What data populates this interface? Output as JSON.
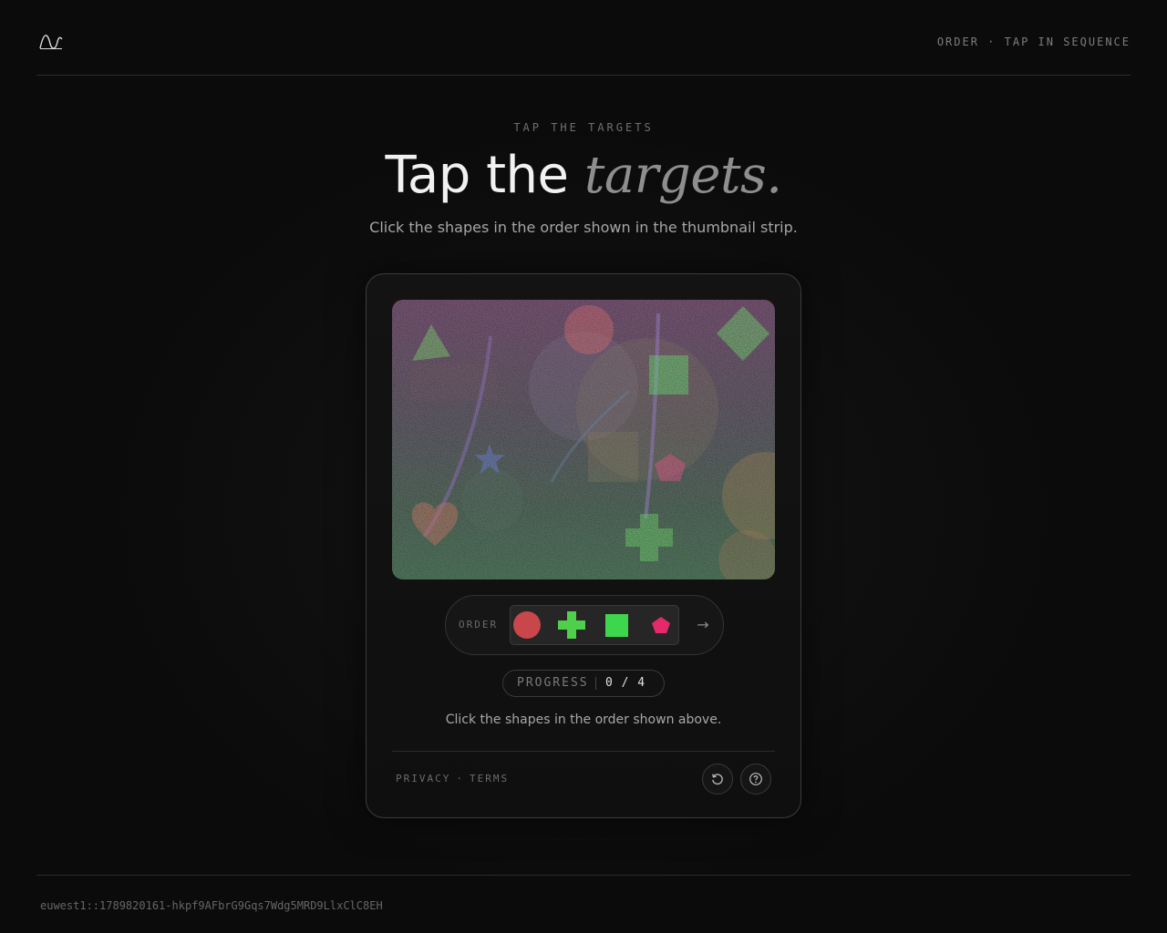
{
  "header": {
    "logo_icon": "wave-logo-icon",
    "mode_label": "ORDER · TAP IN SEQUENCE"
  },
  "hero": {
    "eyebrow": "TAP THE TARGETS",
    "title_plain": "Tap the",
    "title_emphasis": "targets.",
    "subtitle": "Click the shapes in the order shown in the thumbnail strip."
  },
  "challenge": {
    "canvas_shapes": [
      "green-triangle",
      "red-circle",
      "green-diamond",
      "green-square",
      "blue-star",
      "pink-pentagon",
      "orange-heart",
      "green-cross"
    ],
    "order_label": "ORDER",
    "order_sequence": [
      "red-circle",
      "green-cross",
      "green-square",
      "pink-pentagon"
    ],
    "next_icon": "arrow-right-icon",
    "next_symbol": "→",
    "progress_label": "PROGRESS",
    "progress_value": "0 / 4",
    "instruction": "Click the shapes in the order shown above.",
    "links": {
      "privacy": "PRIVACY",
      "separator": "·",
      "terms": "TERMS"
    },
    "refresh_icon": "refresh-icon",
    "help_icon": "help-icon"
  },
  "colors": {
    "background": "#0b0b0b",
    "red_circle": "#c9464a",
    "green_shape": "#4fd04a",
    "square_green": "#3ed64c",
    "pink_pentagon": "#e52a6c",
    "blue_star": "#4a62d4",
    "orange_heart": "#c2553e"
  },
  "footer": {
    "session_id": "euwest1::1789820161-hkpf9AFbrG9Gqs7Wdg5MRD9LlxClC8EH"
  }
}
